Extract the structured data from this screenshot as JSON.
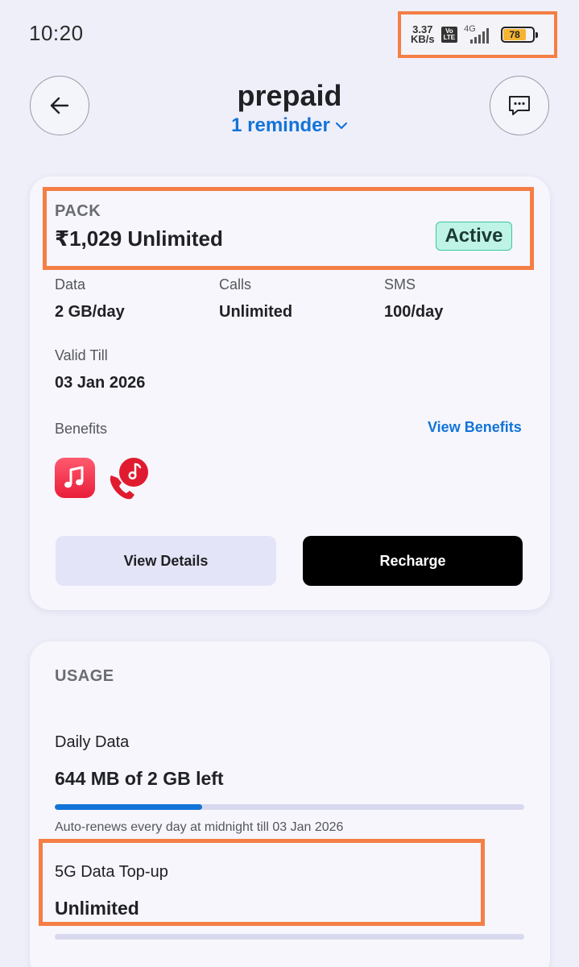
{
  "status_bar": {
    "time": "10:20",
    "speed_value": "3.37",
    "speed_unit": "KB/s",
    "volte_top": "Vo",
    "volte_bottom": "LTE",
    "network": "4G",
    "battery": "78",
    "battery_level": 0.78
  },
  "header": {
    "title": "prepaid",
    "reminder": "1 reminder"
  },
  "pack": {
    "label": "PACK",
    "name": "₹1,029 Unlimited",
    "status": "Active",
    "data_label": "Data",
    "data_value": "2 GB/day",
    "calls_label": "Calls",
    "calls_value": "Unlimited",
    "sms_label": "SMS",
    "sms_value": "100/day",
    "valid_label": "Valid Till",
    "valid_value": "03 Jan 2026",
    "benefits_label": "Benefits",
    "view_benefits": "View Benefits",
    "view_details": "View Details",
    "recharge": "Recharge"
  },
  "usage": {
    "label": "USAGE",
    "daily_label": "Daily Data",
    "daily_value": "644 MB of 2 GB left",
    "daily_fraction": 0.314,
    "renew_note": "Auto-renews every day at midnight till 03 Jan 2026",
    "topup_label": "5G Data Top-up",
    "topup_value": "Unlimited"
  },
  "colors": {
    "accent": "#1274d8",
    "highlight": "#f57e45",
    "active_badge": "#bff3e6",
    "background": "#efeffa"
  }
}
